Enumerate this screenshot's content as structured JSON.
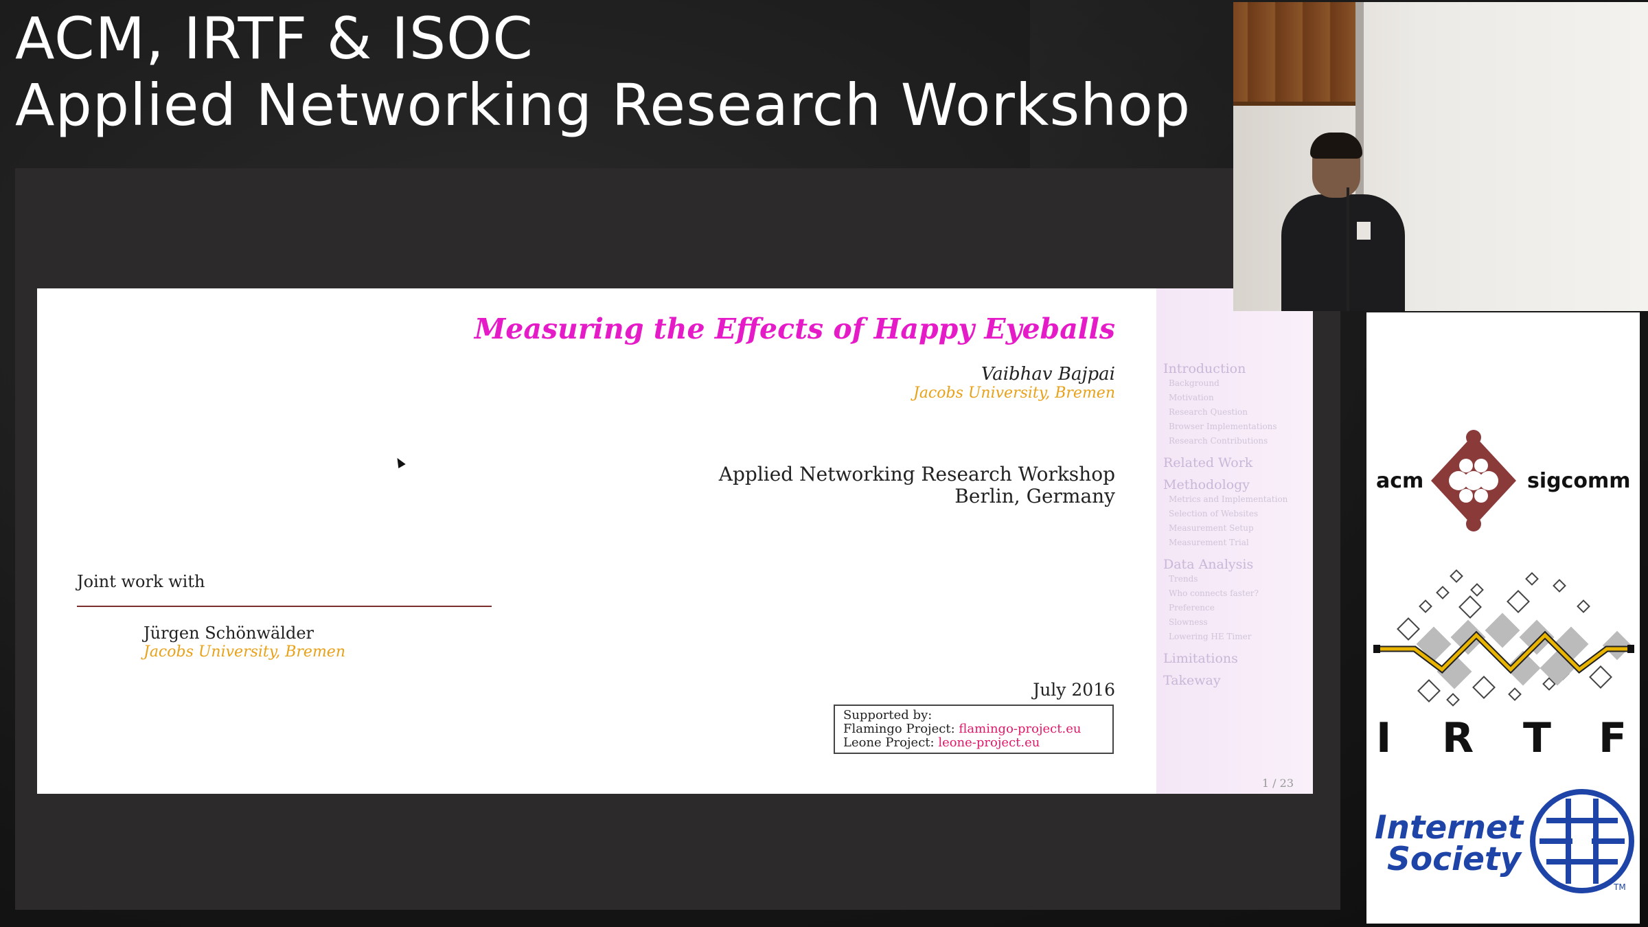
{
  "banner": {
    "line1": "ACM, IRTF & ISOC",
    "line2": "Applied Networking Research Workshop"
  },
  "slide": {
    "title": "Measuring the Effects of Happy Eyeballs",
    "author": "Vaibhav Bajpai",
    "author_affiliation": "Jacobs University, Bremen",
    "venue_line1": "Applied Networking Research Workshop",
    "venue_line2": "Berlin, Germany",
    "joint_label": "Joint work with",
    "coauthor": "Jürgen Schönwälder",
    "coauthor_affiliation": "Jacobs University, Bremen",
    "date": "July 2016",
    "support_heading": "Supported by:",
    "support_line1_label": "Flamingo Project:",
    "support_line1_link": "flamingo-project.eu",
    "support_line2_label": "Leone Project:",
    "support_line2_link": "leone-project.eu",
    "page": "1 / 23",
    "nav": {
      "s1": "Introduction",
      "s1_items": [
        "Background",
        "Motivation",
        "Research Question",
        "Browser Implementations",
        "Research Contributions"
      ],
      "s2": "Related Work",
      "s3": "Methodology",
      "s3_items": [
        "Metrics and Implementation",
        "Selection of Websites",
        "Measurement Setup",
        "Measurement Trial"
      ],
      "s4": "Data Analysis",
      "s4_items": [
        "Trends",
        "Who connects faster?",
        "Preference",
        "Slowness",
        "Lowering HE Timer"
      ],
      "s5": "Limitations",
      "s6": "Takeway"
    }
  },
  "logos": {
    "acm_left": "acm",
    "acm_right": "sigcomm",
    "irtf_letters": [
      "I",
      "R",
      "T",
      "F"
    ],
    "isoc_line1": "Internet",
    "isoc_line2": "Society",
    "isoc_tm": "TM"
  },
  "colors": {
    "slide_title": "#e61bc8",
    "affiliation": "#e8a21a",
    "link": "#e0186a",
    "acm_maroon": "#8b3a3a",
    "isoc_blue": "#1e44a8",
    "irtf_yellow": "#e8b400"
  }
}
